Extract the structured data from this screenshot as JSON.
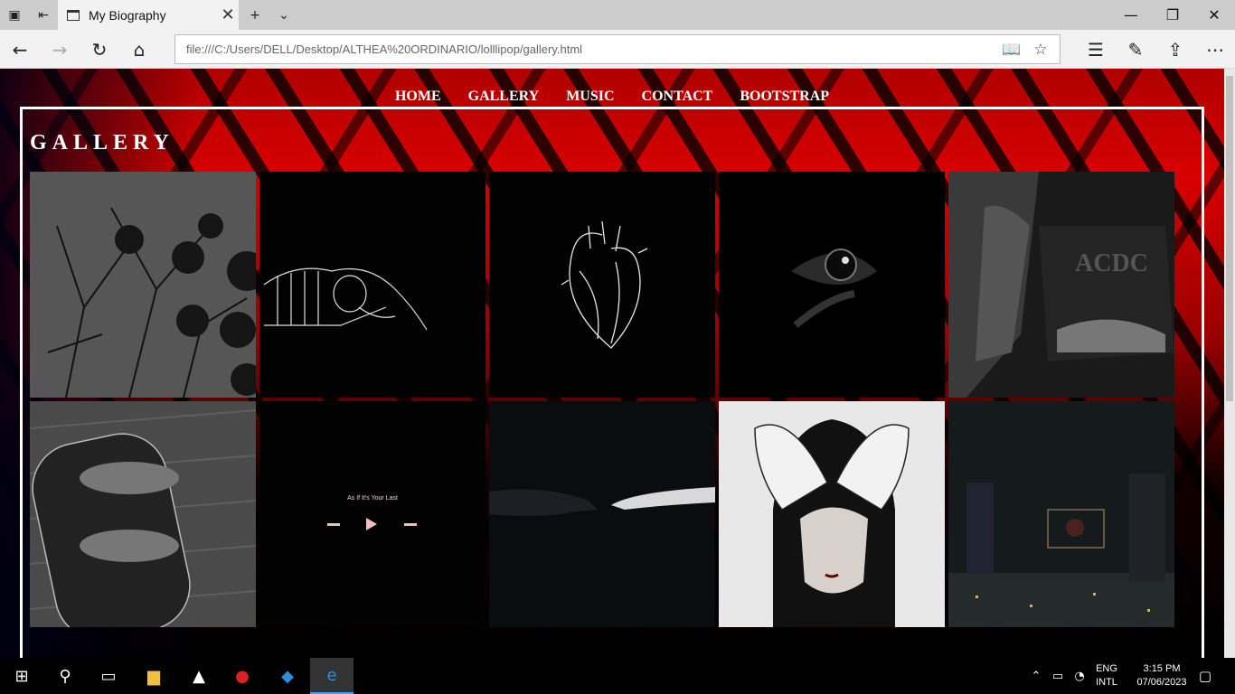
{
  "browser": {
    "tab_title": "My Biography",
    "url": "file:///C:/Users/DELL/Desktop/ALTHEA%20ORDINARIO/lolllipop/gallery.html"
  },
  "page": {
    "menu": [
      "HOME",
      "GALLERY",
      "MUSIC",
      "CONTACT",
      "BOOTSTRAP"
    ],
    "heading": "GALLERY",
    "tiles": [
      {
        "icon": "black-roses-photo"
      },
      {
        "icon": "skeleton-embrace-sketch"
      },
      {
        "icon": "anatomical-heart-sketch"
      },
      {
        "icon": "dark-eye-photo"
      },
      {
        "icon": "woman-rock-shirt-photo"
      },
      {
        "icon": "skateboard-photo"
      },
      {
        "icon": "music-player-screenshot",
        "caption": "As If It's Your Last"
      },
      {
        "icon": "reaching-hands-photo"
      },
      {
        "icon": "manga-girl-covering-eyes"
      },
      {
        "icon": "city-night-collage"
      }
    ]
  },
  "taskbar": {
    "language": [
      "ENG",
      "INTL"
    ],
    "time": "3:15 PM",
    "date": "07/06/2023"
  }
}
